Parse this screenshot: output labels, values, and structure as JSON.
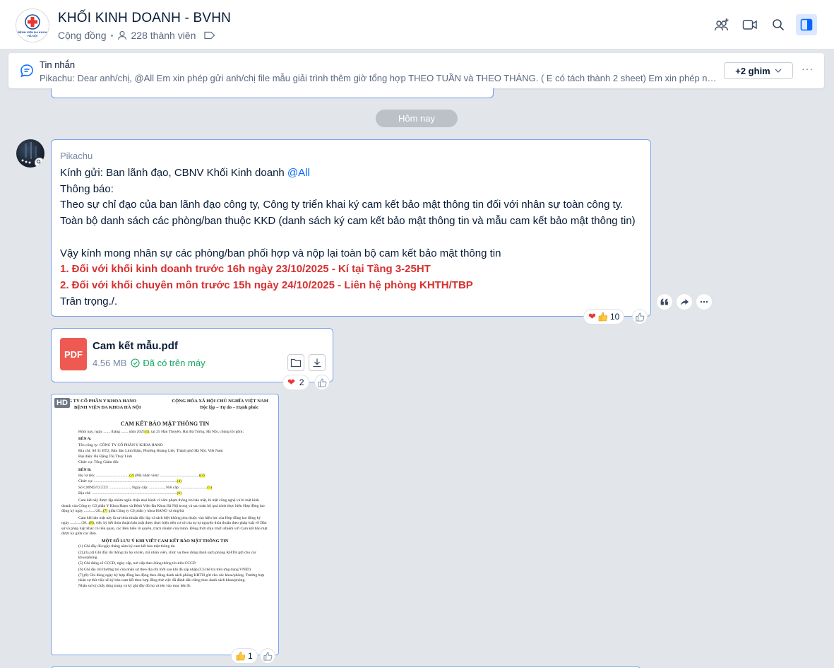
{
  "header": {
    "title": "KHỐI KINH DOANH - BVHN",
    "type_label": "Cộng đồng",
    "members": "228 thành viên",
    "avatar_text": "BỆNH VIỆN ĐA KHOA HÀ NỘI",
    "icons": [
      "add-member-icon",
      "video-call-icon",
      "search-icon",
      "sidebar-toggle-icon"
    ]
  },
  "pinned": {
    "title": "Tin nhắn",
    "text": "Pikachu: Dear anh/chị, @All Em xin phép gửi anh/chị file mẫu giải trình thêm giờ tổng hợp THEO TUẦN và THEO THÁNG. ( E có tách thành 2 sheet) Em xin phép nói...",
    "count_label": "+2 ghim",
    "more": "···"
  },
  "date_divider": "Hôm nay",
  "message": {
    "sender": "Pikachu",
    "line1": "Kính gửi: Ban lãnh đạo, CBNV Khối Kinh doanh ",
    "mention": "@All",
    "line2": "Thông báo:",
    "line3": "Theo sự chỉ đạo của ban lãnh đạo công ty, Công ty triển khai ký cam kết bảo mật thông tin đối với nhân sự toàn công ty.",
    "line4": "Toàn bộ danh sách các phòng/ban thuộc KKD (danh sách ký cam kết bảo mật thông tin và mẫu cam kết bảo mật thông tin)",
    "line5": "Vậy kính mong nhân sự các phòng/ban phối hợp và nộp lại toàn bộ cam kết bảo mật thông tin",
    "line6": "1. Đối với khối kinh doanh trước 16h ngày 23/10/2025 - Kí tại Tầng 3-25HT",
    "line7": "2. Đối với khối chuyên môn trước 15h ngày 24/10/2025 - Liên hệ phòng KHTH/TBP",
    "line8": "Trân trọng./.",
    "reaction_count": "10"
  },
  "file": {
    "icon_label": "PDF",
    "name": "Cam kết mẫu.pdf",
    "size": "4.56 MB",
    "status": "Đã có trên máy",
    "reaction_count": "2"
  },
  "image": {
    "hd": "HD",
    "reaction_count": "1",
    "doc": {
      "left1": "ÔNG TY CỔ PHẦN Y KHOA HANO",
      "right1": "CỘNG HÒA XÃ HỘI CHỦ NGHĨA VIỆT NAM",
      "left2": "BỆNH VIỆN ĐA KHOA HÀ NỘI",
      "right2": "Độc lập – Tự do – Hạnh phúc",
      "title": "CAM KẾT BẢO MẬT THÔNG TIN",
      "p1": "Hôm nay, ngày ....... tháng ....... năm 2025",
      "p1_hl": "(1)",
      "p1b": ", tại 25 Hàn Thuyên, Hai Bà Trưng, Hà Nội, chúng tôi gồm:",
      "ben_a": "BÊN A:",
      "a1": "Tên công ty: CÔNG TY CỔ PHẦN Y KHOA HANO",
      "a2": "Địa chỉ: Số 31 BT2, Bán đảo Linh Đàm, Phường Hoàng Liệt, Thành phố Hà Nội, Việt Nam",
      "a3": "Đại diện: Bà Đặng Thị Thuỳ Linh",
      "a4": "Chức vụ: Tổng Giám đốc",
      "ben_b": "BÊN B:",
      "b1": "Họ và tên: ..................................",
      "b1_hl": "(2)",
      "b1b": " (Mã nhân viên: .......................................)",
      "b1_hl2": "(3)",
      "b2": "Chức vụ: ....................................................................................",
      "b2_hl": "(4)",
      "b3": "Số CMND/CCCD: ....................., Ngày cấp: ..............., Nơi cấp: ...........................",
      "b3_hl": "(5)",
      "b4": "Địa chỉ: ......................................................................................",
      "b4_hl": "(6)",
      "p2": "Cam kết này được lập nhằm ngăn chặn mọi hành vi xâm phạm thông tin bảo mật, bí mật công nghệ và bí mật kinh doanh của Công ty Cổ phần Y Khoa Hano và Bệnh Viện Đa Khoa Hà Nội trong và sau toàn bộ quá trình thực hiện Hợp đồng lao động ký ngày ...../...../20...",
      "p2_hl": "(7)",
      "p2b": " giữa Công ty Cổ phần y khoa HANO và ông/bà",
      "p3": "Cam kết bảo mật này là sự thỏa thuận độc lập và tách biệt không phụ thuộc vào hiệu lực của Hợp đồng lao động ký ngày ...../...../20...",
      "p3_hl": "(8)",
      "p3b": ", việc ký kết thỏa thuận bảo mật được thực hiện trên cơ sở của sự tự nguyện thỏa thuận theo pháp luật về Dân sự và pháp luật khác có liên quan, các Bên hiểu rõ quyền, trách nhiệm của mình. Đồng thời chịu trách nhiệm với Cam kết bảo mật được ký giữa các Bên.",
      "sec": "MỘT SỐ LƯU Ý KHI VIẾT CAM KẾT BẢO MẬT THÔNG TIN",
      "n1": "(1) Ghi đầy đủ ngày tháng năm ký cam kết bảo mật thông tin",
      "n2": "(2),(3),(4) Ghi đầy đủ thông tin họ và tên, mã nhân viên, chức vụ theo đúng danh sách phòng KHTH gửi cho các khoa/phòng",
      "n3": "(5) Ghi đúng số CCCD, ngày cấp, nơi cấp theo đúng thông tin trên CCCD",
      "n4": "(6) Ghi địa chỉ thường trú của nhân sự theo địa chỉ mới sau khi đã sáp nhập (Có thể tra trên ứng dụng VNID)",
      "n5": "(7),(8) Ghi đúng ngày ký hợp đồng lao động theo đúng danh sách phòng KHTH gửi cho các khoa/phòng. Trường hợp nhân sự thử việc sẽ ký bản cam kết theo hợp đồng thử việc đã đánh dấu riêng theo danh sách khoa/phòng.",
      "n6": "Nhân sự ký chấy từng trang và ký ghi đầy đủ họ và tên vào mục bên B."
    }
  },
  "colors": {
    "accent": "#0068ff",
    "bubble_border": "#7aa3ee",
    "alert": "#d8302f",
    "pdf": "#ee5a52",
    "success": "#15a85f"
  }
}
